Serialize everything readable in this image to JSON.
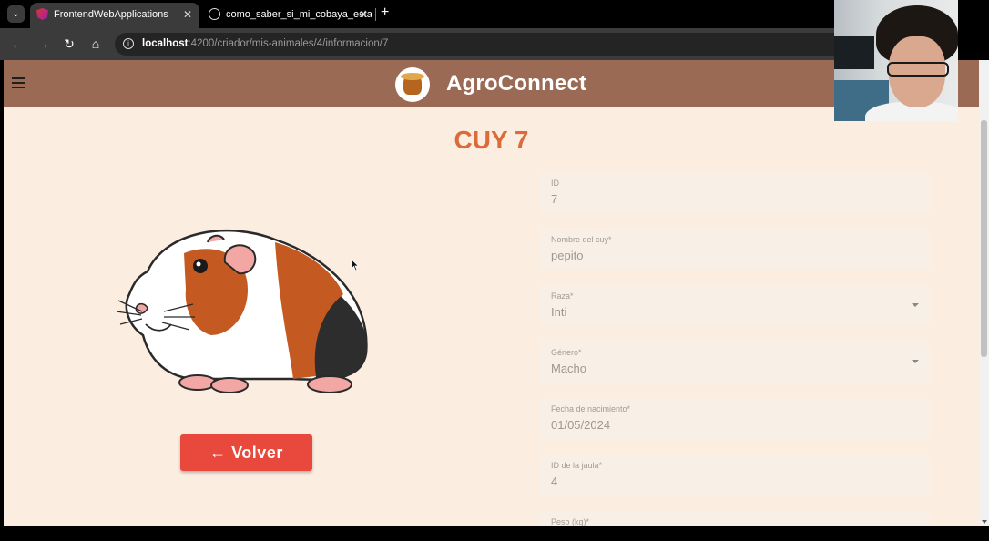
{
  "browser": {
    "tabs": [
      {
        "title": "FrontendWebApplications",
        "active": true
      },
      {
        "title": "como_saber_si_mi_cobaya_esta",
        "active": false
      }
    ],
    "url_host": "localhost",
    "url_rest": ":4200/criador/mis-animales/4/informacion/7",
    "new_tab": "+",
    "close_glyph": "✕"
  },
  "app": {
    "title": "AgroConnect",
    "colors": {
      "appbar": "#9b6a54",
      "background": "#fbede0",
      "heading": "#dc6b3b",
      "button": "#e8493c"
    }
  },
  "page": {
    "heading": "CUY 7",
    "back_button": "← Volver"
  },
  "form": {
    "fields": [
      {
        "label": "ID",
        "value": "7"
      },
      {
        "label": "Nombre del cuy*",
        "value": "pepito"
      },
      {
        "label": "Raza*",
        "value": "Inti"
      },
      {
        "label": "Género*",
        "value": "Macho"
      },
      {
        "label": "Fecha de nacimiento*",
        "value": "01/05/2024"
      },
      {
        "label": "ID de la jaula*",
        "value": "4"
      },
      {
        "label": "Peso (kg)*",
        "value": ""
      }
    ]
  }
}
